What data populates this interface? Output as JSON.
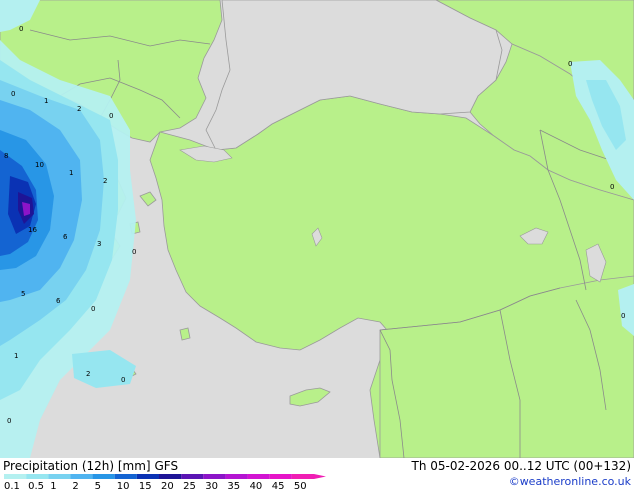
{
  "title": "Precipitation (12h) [mm]",
  "model": "GFS",
  "valid_time": "Th 05-02-2026 00..12 UTC (00+132)",
  "credit": "©weatheronline.co.uk",
  "colors": {
    "sea": "#dcdcdc",
    "land": "#b8f08a",
    "border": "#8a8a8a",
    "coast": "#9a9a9a",
    "credit": "#1a3cc8"
  },
  "legend": {
    "ticks": [
      "0.1",
      "0.5",
      "1",
      "2",
      "5",
      "10",
      "15",
      "20",
      "25",
      "30",
      "35",
      "40",
      "45",
      "50"
    ],
    "colors": [
      "#b4f0f0",
      "#96e6f0",
      "#78d2f0",
      "#50b4f0",
      "#2896e6",
      "#1464d2",
      "#0a32b4",
      "#1e1496",
      "#5a14b4",
      "#8c14c8",
      "#b414d2",
      "#d214d2",
      "#e614c8",
      "#f01eb4"
    ]
  },
  "contour_labels": [
    "0",
    "0",
    "1",
    "2",
    "0",
    "8",
    "10",
    "1",
    "2",
    "16",
    "6",
    "3",
    "0",
    "5",
    "6",
    "0",
    "1",
    "2",
    "0",
    "0",
    "0",
    "0",
    "0"
  ]
}
